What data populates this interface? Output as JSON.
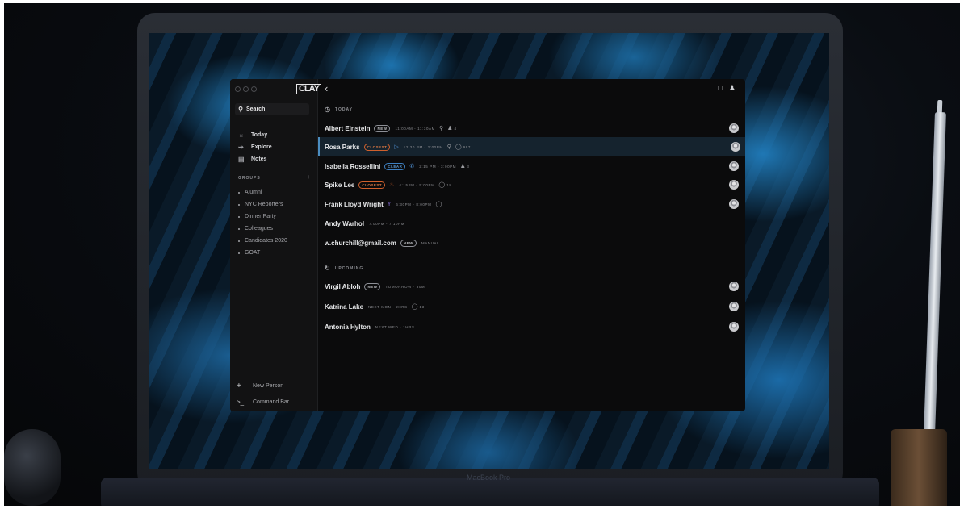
{
  "sidebar": {
    "logo": "CLAY",
    "search_label": "Search",
    "nav": [
      {
        "label": "Today",
        "icon": "sun-icon"
      },
      {
        "label": "Explore",
        "icon": "explore-icon"
      },
      {
        "label": "Notes",
        "icon": "notes-icon"
      }
    ],
    "groups_heading": "GROUPS",
    "groups_add": "+",
    "groups": [
      "Alumni",
      "NYC Reporters",
      "Dinner Party",
      "Colleagues",
      "Candidates 2020",
      "GOAT"
    ],
    "bottom": [
      {
        "label": "New Person",
        "icon": "plus-icon"
      },
      {
        "label": "Command Bar",
        "icon": "terminal-icon"
      }
    ]
  },
  "main": {
    "back": "‹",
    "sections": {
      "today": "TODAY",
      "upcoming": "UPCOMING"
    },
    "today_rows": [
      {
        "name": "Albert Einstein",
        "badge": "NEW",
        "badge_type": "new",
        "meta": "11:00AM - 11:30AM",
        "extra": "4"
      },
      {
        "name": "Rosa Parks",
        "badge": "CLOSEST",
        "badge_type": "closest",
        "meta": "12:30 PM - 2:00PM",
        "extra": "997"
      },
      {
        "name": "Isabella Rossellini",
        "badge": "CLEAR",
        "badge_type": "clear",
        "meta": "2:15 PM - 3:00PM",
        "extra": "3"
      },
      {
        "name": "Spike Lee",
        "badge": "CLOSEST",
        "badge_type": "closest",
        "meta": "4:15PM - 5:00PM",
        "extra": "18"
      },
      {
        "name": "Frank Lloyd Wright",
        "badge": "",
        "badge_type": "",
        "meta": "6:30PM - 8:00PM",
        "extra": ""
      },
      {
        "name": "Andy Warhol",
        "badge": "",
        "badge_type": "",
        "meta": "7:00PM - 7:10PM",
        "extra": ""
      },
      {
        "name": "w.churchill@gmail.com",
        "badge": "NEW",
        "badge_type": "new",
        "meta": "MANUAL",
        "extra": ""
      }
    ],
    "upcoming_rows": [
      {
        "name": "Virgil Abloh",
        "badge": "NEW",
        "badge_type": "new",
        "meta": "TOMORROW · 30M",
        "extra": ""
      },
      {
        "name": "Katrina Lake",
        "badge": "",
        "badge_type": "",
        "meta": "NEXT MON · 2HRS",
        "extra": "13"
      },
      {
        "name": "Antonia Hylton",
        "badge": "",
        "badge_type": "",
        "meta": "NEXT WED · 1HRS",
        "extra": ""
      }
    ]
  },
  "device": {
    "brand": "MacBook Pro"
  },
  "colors": {
    "selected_row": "#15232e",
    "closest_badge": "#d0602c",
    "clear_badge": "#3d7fc1"
  }
}
